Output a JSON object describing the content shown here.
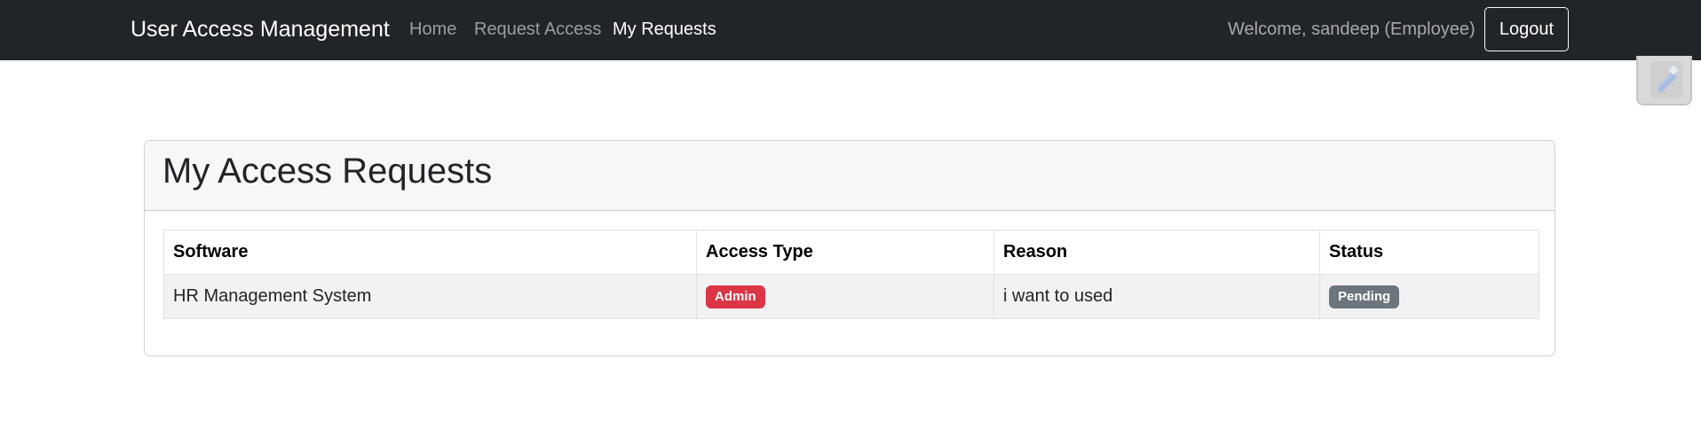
{
  "navbar": {
    "brand": "User Access Management",
    "links": [
      {
        "label": "Home",
        "active": false
      },
      {
        "label": "Request Access",
        "active": false
      },
      {
        "label": "My Requests",
        "active": true
      }
    ],
    "welcome_text": "Welcome, sandeep (Employee)",
    "logout_label": "Logout"
  },
  "extension_widget": {
    "icon": "extension-icon"
  },
  "card": {
    "title": "My Access Requests",
    "table": {
      "headers": [
        "Software",
        "Access Type",
        "Reason",
        "Status"
      ],
      "rows": [
        {
          "software": "HR Management System",
          "access_type": "Admin",
          "access_type_color": "#dc3545",
          "reason": "i want to used",
          "status": "Pending",
          "status_color": "#6c757d"
        }
      ]
    }
  },
  "colors": {
    "navbar_bg": "#212529",
    "badge_admin": "#dc3545",
    "badge_pending": "#6c757d"
  }
}
